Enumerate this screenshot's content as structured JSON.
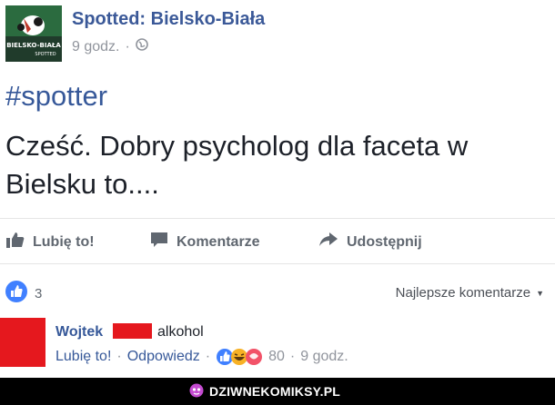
{
  "post": {
    "page_name": "Spotted: Bielsko-Biała",
    "time": "9 godz.",
    "audience_icon": "globe-icon",
    "logo_text": [
      "BIELSKO-BIAŁA",
      "SPOTTED"
    ],
    "hashtag": "#spotter",
    "text_line1": "Cześć. Dobry psycholog dla faceta w",
    "text_line2": "Bielsku to...."
  },
  "actions": {
    "like": "Lubię to!",
    "comment": "Komentarze",
    "share": "Udostępnij"
  },
  "likes": {
    "count": "3",
    "icon": "thumbs-up-icon"
  },
  "comments": {
    "sort_label": "Najlepsze komentarze",
    "items": [
      {
        "author": "Wojtek",
        "text": "alkohol",
        "like_label": "Lubię to!",
        "reply_label": "Odpowiedz",
        "reaction_count": "80",
        "time": "9 godz."
      }
    ]
  },
  "footer": {
    "site": "DZIWNEKOMIKSY.PL"
  },
  "colors": {
    "link": "#365899",
    "redaction": "#e5181e",
    "footer": "#000000"
  }
}
